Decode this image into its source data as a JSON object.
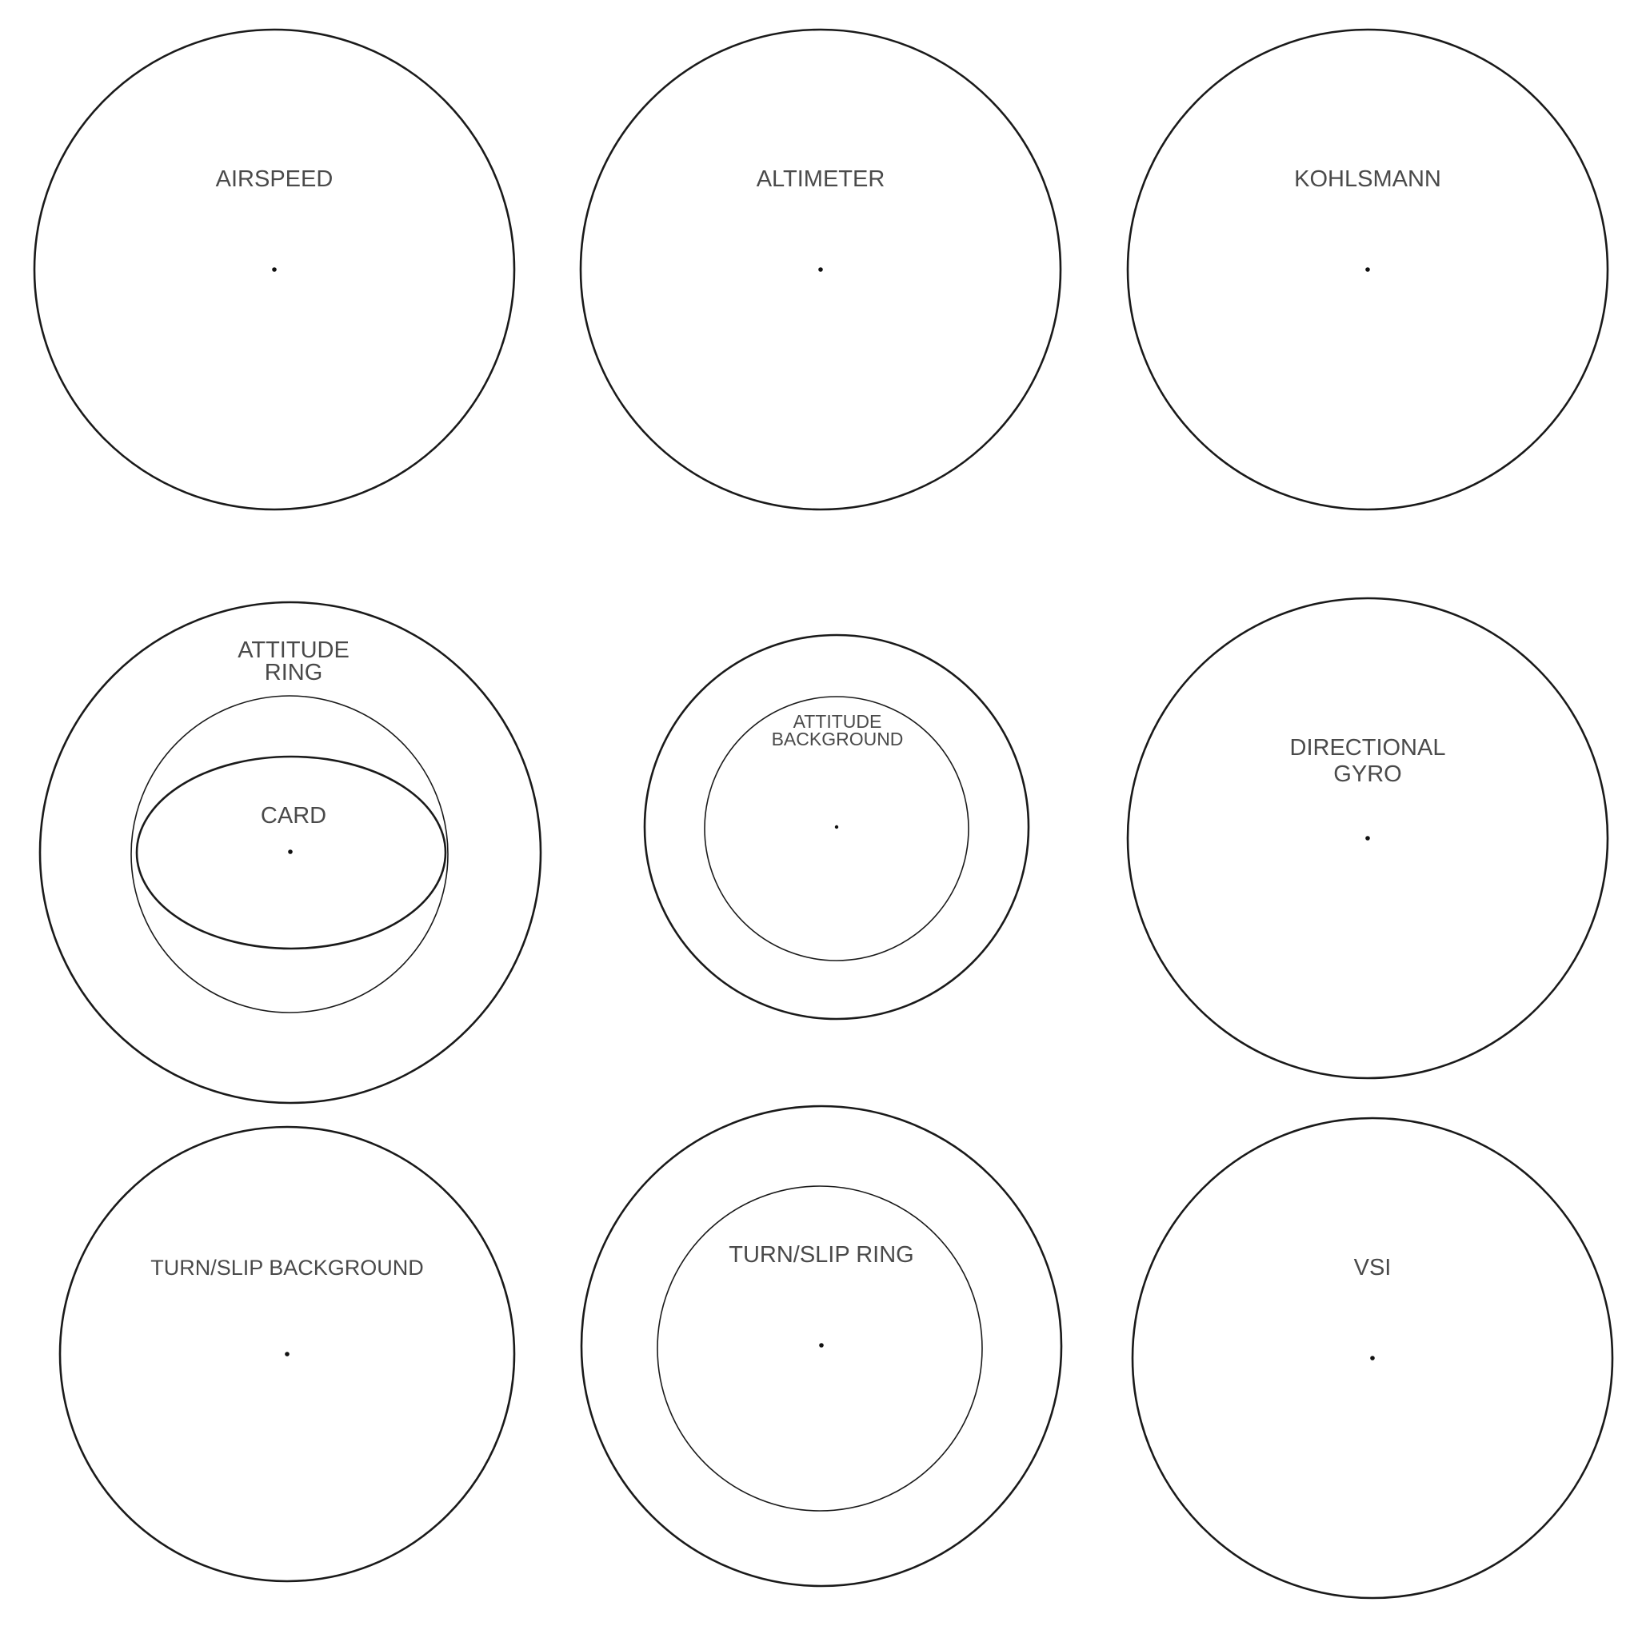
{
  "labels": {
    "airspeed": "AIRSPEED",
    "altimeter": "ALTIMETER",
    "kohlsmann": "KOHLSMANN",
    "attitude_ring_line1": "ATTITUDE",
    "attitude_ring_line2": "RING",
    "card": "CARD",
    "attitude_background_line1": "ATTITUDE",
    "attitude_background_line2": "BACKGROUND",
    "directional_gyro_line1": "DIRECTIONAL",
    "directional_gyro_line2": "GYRO",
    "turn_slip_background": "TURN/SLIP BACKGROUND",
    "turn_slip_ring": "TURN/SLIP RING",
    "vsi": "VSI"
  }
}
